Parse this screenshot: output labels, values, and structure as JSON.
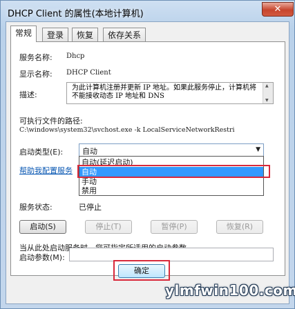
{
  "window": {
    "title": "DHCP Client 的属性(本地计算机)",
    "close_glyph": "✕"
  },
  "tabs": [
    {
      "label": "常规"
    },
    {
      "label": "登录"
    },
    {
      "label": "恢复"
    },
    {
      "label": "依存关系"
    }
  ],
  "general": {
    "service_name_label": "服务名称:",
    "service_name": "Dhcp",
    "display_name_label": "显示名称:",
    "display_name": "DHCP Client",
    "description_label": "描述:",
    "description": "为此计算机注册并更新 IP 地址。如果此服务停止，计算机将不能接收动态 IP 地址和 DNS",
    "exe_path_label": "可执行文件的路径:",
    "exe_path": "C:\\windows\\system32\\svchost.exe -k LocalServiceNetworkRestri",
    "startup_type_label": "启动类型(E):",
    "startup_type_value": "自动",
    "startup_options": [
      "自动(延迟启动)",
      "自动",
      "手动",
      "禁用"
    ],
    "startup_selected_index": 1,
    "help_link": "帮助我配置服务",
    "status_label": "服务状态:",
    "status_value": "已停止",
    "buttons": {
      "start": "启动(S)",
      "stop": "停止(T)",
      "pause": "暂停(P)",
      "resume": "恢复(R)"
    },
    "hint": "当从此处启动服务时，您可指定所适用的启动参数。",
    "params_label": "启动参数(M):",
    "params_value": ""
  },
  "footer": {
    "ok": "确定"
  },
  "watermark": "ylmfwin100.com",
  "colors": {
    "selection": "#3399ff",
    "annotation_red": "#d8283a",
    "link": "#0a58b3"
  },
  "icons": {
    "dropdown": "chevron-down-icon",
    "close": "close-icon"
  }
}
